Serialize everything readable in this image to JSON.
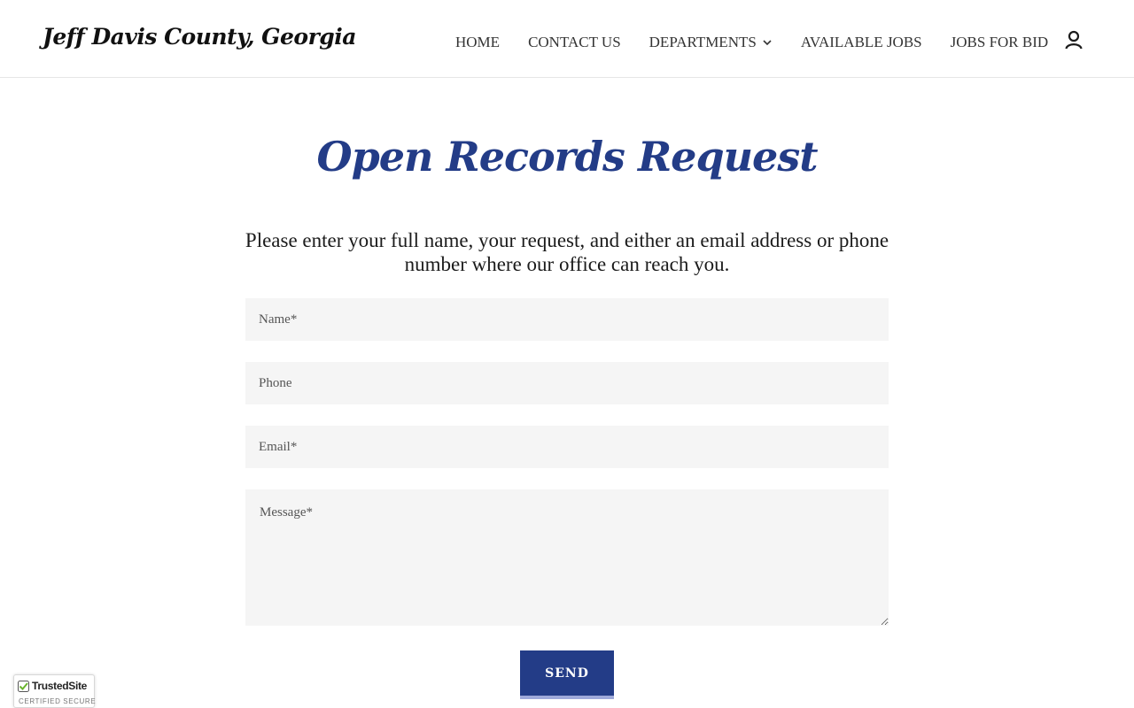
{
  "header": {
    "logo": "Jeff Davis County, Georgia",
    "nav": [
      {
        "label": "HOME"
      },
      {
        "label": "CONTACT US"
      },
      {
        "label": "DEPARTMENTS",
        "has_dropdown": true
      },
      {
        "label": "AVAILABLE JOBS"
      },
      {
        "label": "JOBS FOR BID"
      }
    ],
    "account_icon": "user-icon"
  },
  "main": {
    "title": "Open Records Request",
    "intro": "Please enter your full name, your request, and either an email address or phone number where our office can reach you.",
    "form": {
      "name_placeholder": "Name*",
      "phone_placeholder": "Phone",
      "email_placeholder": "Email*",
      "message_placeholder": "Message*",
      "send_label": "SEND"
    }
  },
  "badge": {
    "name": "TrustedSite",
    "subtitle": "CERTIFIED SECURE",
    "check_color": "#6ab42d"
  },
  "colors": {
    "accent": "#233c87",
    "button_underline": "#9ea9da",
    "field_bg": "#f5f5f5"
  }
}
